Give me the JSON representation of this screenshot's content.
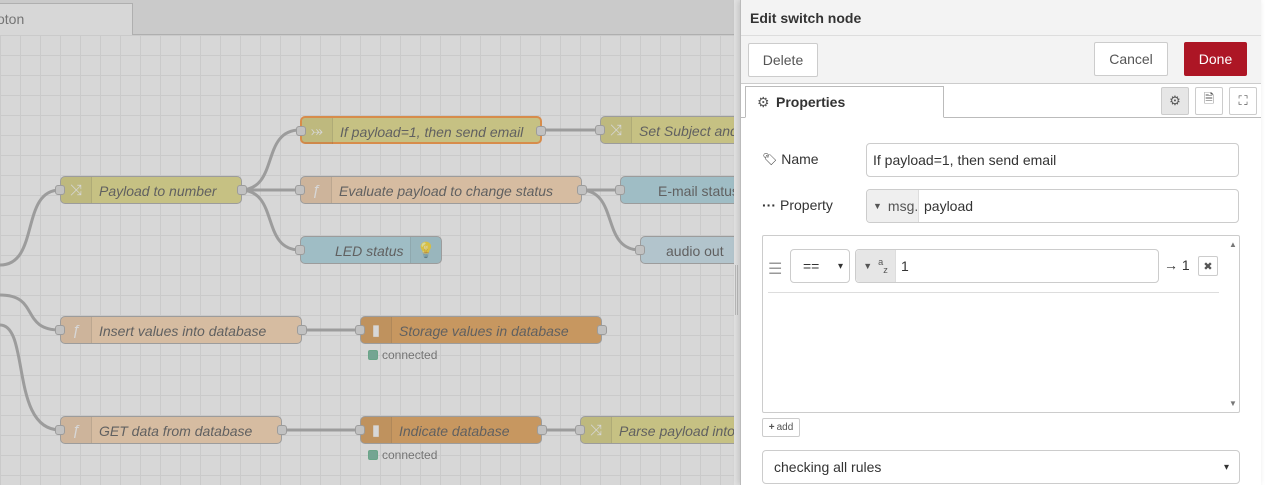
{
  "workspace": {
    "tab_label": "oton",
    "nodes": [
      {
        "label": "Payload to number",
        "icon": "shuffle-icon",
        "type": "change"
      },
      {
        "label": "If payload=1, then send email",
        "icon": "switch-icon",
        "type": "switch"
      },
      {
        "label": "Evaluate payload to change status",
        "icon": "function-icon",
        "type": "function"
      },
      {
        "label": "LED status",
        "icon": "bulb-icon",
        "type": "ui"
      },
      {
        "label": "Set Subject and",
        "icon": "shuffle-icon",
        "type": "change"
      },
      {
        "label": "E-mail status",
        "icon": "",
        "type": "ui"
      },
      {
        "label": "audio out",
        "icon": "",
        "type": "audio"
      },
      {
        "label": "Insert values into database",
        "icon": "function-icon",
        "type": "function"
      },
      {
        "label": "Storage values in database",
        "icon": "database-icon",
        "type": "database"
      },
      {
        "label": "GET data from database",
        "icon": "function-icon",
        "type": "function"
      },
      {
        "label": "Indicate database",
        "icon": "database-icon",
        "type": "database"
      },
      {
        "label": "Parse payload into",
        "icon": "shuffle-icon",
        "type": "change"
      }
    ],
    "status_connected": "connected",
    "colors": {
      "change": "#e2d96e",
      "function": "#fdd0a2",
      "database": "#e49132",
      "ui": "#9fd3e0",
      "audio": "#c0deed",
      "selected": "#ff7f0e"
    }
  },
  "tray": {
    "title": "Edit switch node",
    "delete_label": "Delete",
    "cancel_label": "Cancel",
    "done_label": "Done",
    "done_color": "#ad1625",
    "tab_properties": "Properties",
    "name_label": "Name",
    "name_value": "If payload=1, then send email",
    "property_label": "Property",
    "property_type": "msg.",
    "property_value": "payload",
    "rule": {
      "operator": "==",
      "value_type_icon": "az",
      "value": "1",
      "output": "→ 1"
    },
    "add_label": "add",
    "checking_option": "checking all rules"
  }
}
